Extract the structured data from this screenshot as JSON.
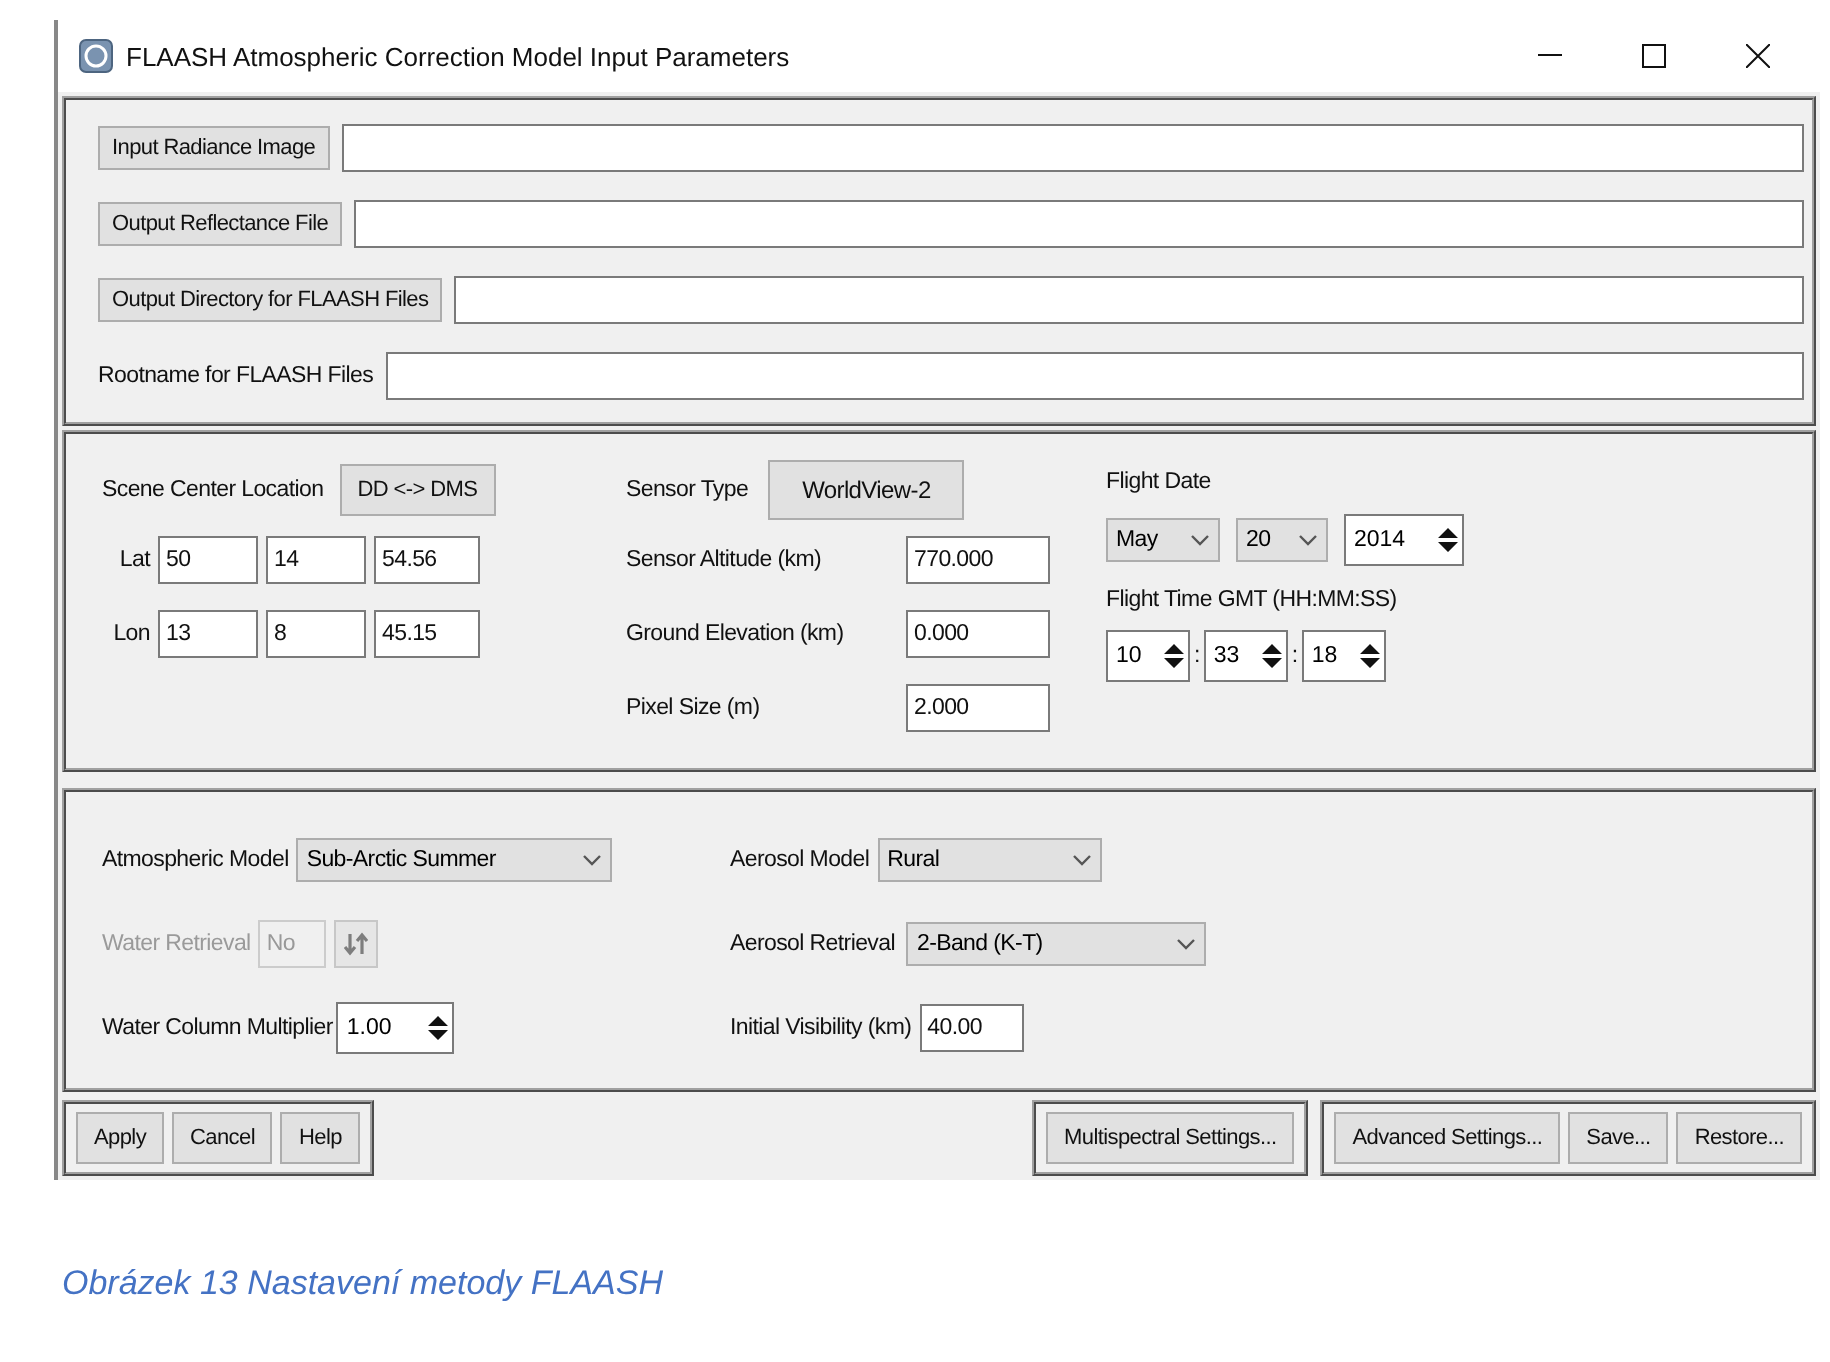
{
  "window": {
    "title": "FLAASH Atmospheric Correction Model Input Parameters"
  },
  "file_fields": [
    {
      "kind": "button",
      "label": "Input Radiance Image"
    },
    {
      "kind": "button",
      "label": "Output Reflectance File"
    },
    {
      "kind": "button",
      "label": "Output Directory for FLAASH Files"
    },
    {
      "kind": "label",
      "label": "Rootname for FLAASH Files"
    }
  ],
  "scene": {
    "label": "Scene Center Location",
    "toggle": "DD <-> DMS",
    "coords": [
      {
        "label": "Lat",
        "values": [
          "50",
          "14",
          "54.56"
        ]
      },
      {
        "label": "Lon",
        "values": [
          "13",
          "8",
          "45.15"
        ]
      }
    ]
  },
  "sensor": {
    "type_label": "Sensor Type",
    "type_value": "WorldView-2",
    "fields": [
      {
        "label": "Sensor Altitude (km)",
        "value": "770.000"
      },
      {
        "label": "Ground Elevation (km)",
        "value": "0.000"
      },
      {
        "label": "Pixel Size (m)",
        "value": "2.000"
      }
    ]
  },
  "flight": {
    "date_label": "Flight Date",
    "month": "May",
    "day": "20",
    "year": "2014",
    "time_label": "Flight Time GMT (HH:MM:SS)",
    "time": [
      "10",
      "33",
      "18"
    ],
    "separator": ":"
  },
  "atmosphere": {
    "model": {
      "label": "Atmospheric Model",
      "value": "Sub-Arctic Summer"
    },
    "water_retrieval": {
      "label": "Water Retrieval",
      "value": "No",
      "disabled": true
    },
    "multiplier": {
      "label": "Water Column Multiplier",
      "value": "1.00"
    }
  },
  "aerosol": {
    "model": {
      "label": "Aerosol Model",
      "value": "Rural"
    },
    "retrieval": {
      "label": "Aerosol Retrieval",
      "value": "2-Band (K-T)"
    },
    "visibility": {
      "label": "Initial Visibility (km)",
      "value": "40.00"
    }
  },
  "button_groups": [
    [
      "Apply",
      "Cancel",
      "Help"
    ],
    [
      "Multispectral Settings..."
    ],
    [
      "Advanced Settings...",
      "Save...",
      "Restore..."
    ]
  ],
  "caption": "Obrázek 13 Nastavení metody FLAASH"
}
